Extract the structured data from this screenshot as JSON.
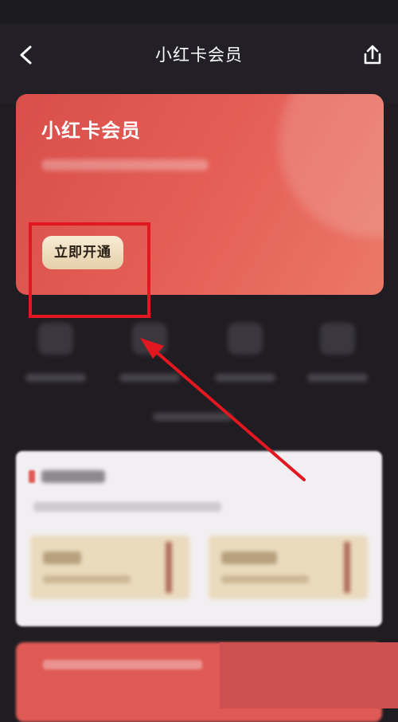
{
  "nav": {
    "title": "小红卡会员",
    "back_icon": "chevron-left-icon",
    "share_icon": "share-icon"
  },
  "hero": {
    "title": "小红卡会员",
    "cta_label": "立即开通"
  },
  "colors": {
    "annotation": "#e2171f",
    "hero_card": "#e05a55",
    "cta": "#efdcbb",
    "background": "#1f1d22"
  }
}
